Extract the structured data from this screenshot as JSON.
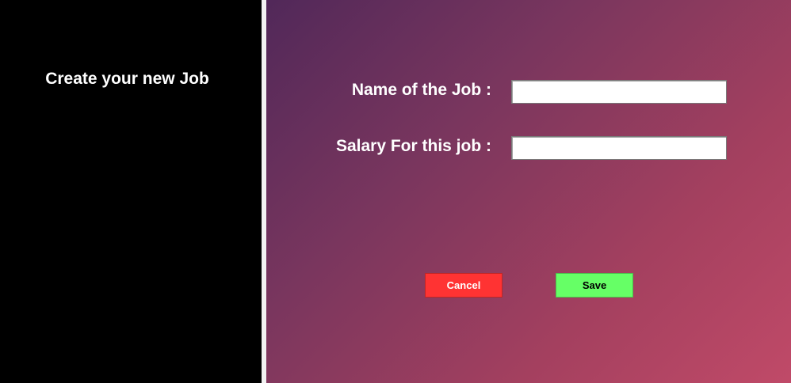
{
  "sidebar": {
    "title": "Create your new Job"
  },
  "form": {
    "name_label": "Name of the Job :",
    "name_value": "",
    "salary_label": "Salary For this job :",
    "salary_value": ""
  },
  "buttons": {
    "cancel_label": "Cancel",
    "save_label": "Save"
  },
  "colors": {
    "sidebar_bg": "#000000",
    "gradient_start": "#512859",
    "gradient_end": "#c04a68",
    "cancel_bg": "#ff3333",
    "save_bg": "#66ff66"
  }
}
